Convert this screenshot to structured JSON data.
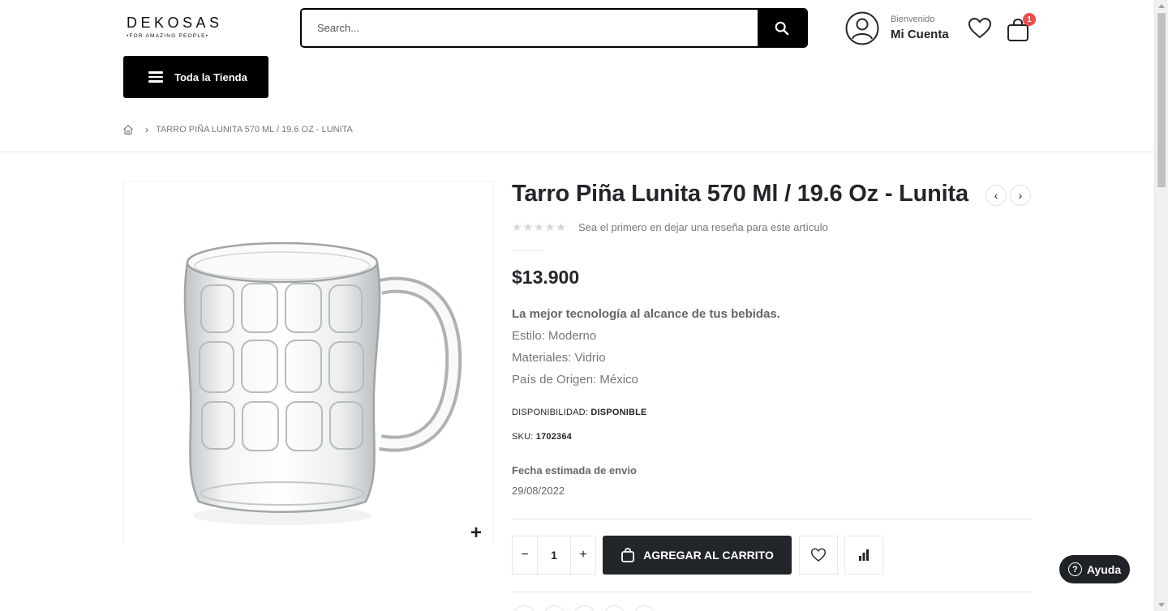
{
  "header": {
    "logo_main": "DEKOSAS",
    "logo_sub": "•FOR AMAZING PEOPLE•",
    "search_placeholder": "Search...",
    "account_welcome": "Bienvenido",
    "account_name": "Mi Cuenta",
    "cart_count": "1",
    "all_store_label": "Toda la Tienda"
  },
  "breadcrumb": {
    "current": "TARRO PIÑA LUNITA 570 ML / 19.6 OZ - LUNITA"
  },
  "product": {
    "title": "Tarro Piña Lunita 570 Ml / 19.6 Oz - Lunita",
    "rating_stars": 0,
    "review_text": "Sea el primero en dejar una reseña para este artículo",
    "price": "$13.900",
    "tagline": "La mejor tecnología al alcance de tus bebidas.",
    "style": "Estilo: Moderno",
    "materials": "Materiales: Vidrio",
    "origin": "País de Origen: México",
    "availability_label": "DISPONIBILIDAD:",
    "availability_value": "DISPONIBLE",
    "sku_label": "SKU:",
    "sku_value": "1702364",
    "shipping_label": "Fecha estimada de envio",
    "shipping_date": "29/08/2022",
    "quantity": "1",
    "add_to_cart_label": "AGREGAR AL CARRITO"
  },
  "icons": {
    "search": "search-icon",
    "account": "user-circle-icon",
    "wishlist": "heart-icon",
    "cart": "shopping-bag-icon",
    "home": "home-icon",
    "compare": "bar-chart-icon"
  },
  "help": {
    "label": "Ayuda"
  },
  "colors": {
    "primary_dark": "#222529",
    "black": "#000000",
    "badge_red": "#ee4b4b",
    "text_muted": "#777777"
  }
}
